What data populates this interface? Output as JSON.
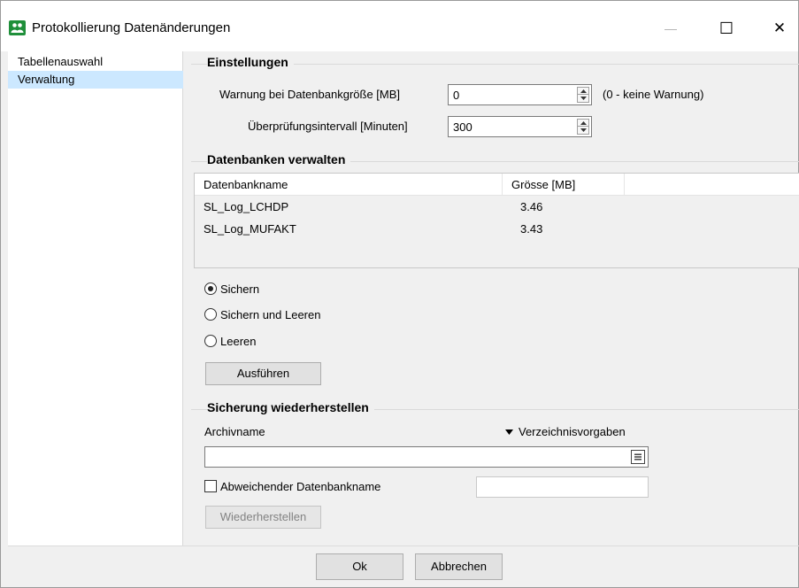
{
  "window": {
    "title": "Protokollierung Datenänderungen",
    "minimize_glyph": "—",
    "maximize_glyph": "☐",
    "close_glyph": "✕"
  },
  "sidebar": {
    "items": [
      {
        "label": "Tabellenauswahl",
        "selected": false
      },
      {
        "label": "Verwaltung",
        "selected": true
      }
    ]
  },
  "einstellungen": {
    "title": "Einstellungen",
    "warnung_label": "Warnung bei Datenbankgröße [MB]",
    "warnung_value": "0",
    "warnung_hint": "(0 - keine Warnung)",
    "intervall_label": "Überprüfungsintervall [Minuten]",
    "intervall_value": "300"
  },
  "datenbanken": {
    "title": "Datenbanken verwalten",
    "columns": [
      "Datenbankname",
      "Grösse [MB]"
    ],
    "rows": [
      {
        "name": "SL_Log_LCHDP",
        "size": "3.46"
      },
      {
        "name": "SL_Log_MUFAKT",
        "size": "3.43"
      }
    ],
    "options": [
      {
        "label": "Sichern",
        "checked": true
      },
      {
        "label": "Sichern und Leeren",
        "checked": false
      },
      {
        "label": "Leeren",
        "checked": false
      }
    ],
    "run_label": "Ausführen"
  },
  "restore": {
    "title": "Sicherung wiederherstellen",
    "archive_label": "Archivname",
    "defaults_label": "Verzeichnisvorgaben",
    "archive_value": "",
    "alt_db_label": "Abweichender Datenbankname",
    "alt_db_value": "",
    "restore_label": "Wiederherstellen"
  },
  "footer": {
    "ok_label": "Ok",
    "cancel_label": "Abbrechen"
  }
}
